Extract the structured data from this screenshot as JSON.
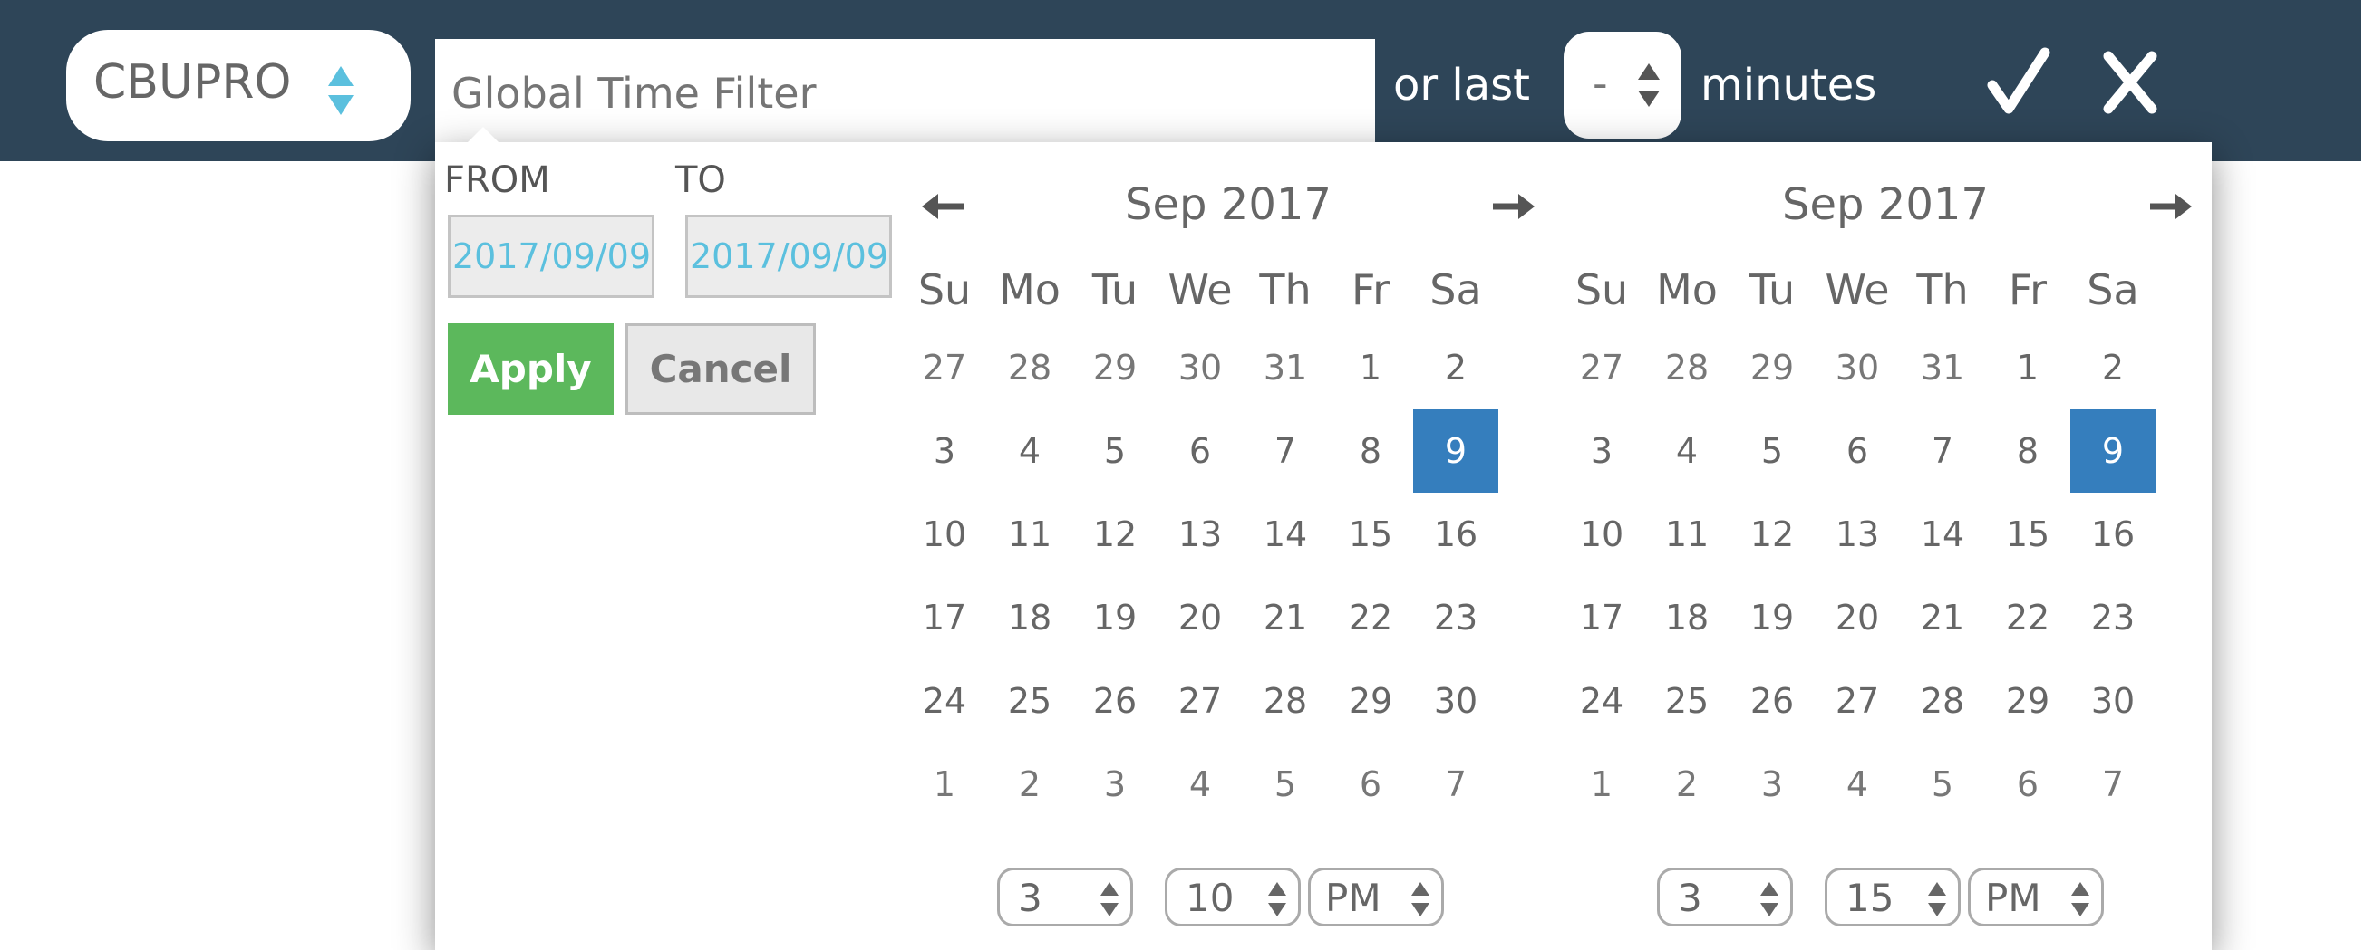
{
  "topbar": {
    "site_select": {
      "value": "CBUPRO"
    },
    "filter_input": {
      "placeholder": "Global Time Filter"
    },
    "or_last_label": "or last",
    "minutes_select": {
      "value": "-"
    },
    "minutes_label": "minutes",
    "confirm_icon": "checkmark-icon",
    "close_icon": "close-x-icon"
  },
  "range": {
    "from_label": "FROM",
    "to_label": "TO",
    "from_value": "2017/09/09",
    "to_value": "2017/09/09",
    "apply_label": "Apply",
    "cancel_label": "Cancel"
  },
  "colors": {
    "topbar_bg": "#2e4558",
    "apply_bg": "#5cb85c",
    "active_day_bg": "#357ebd",
    "date_text": "#5bc0de"
  },
  "calendars": [
    {
      "title": "Sep 2017",
      "weekdays": [
        "Su",
        "Mo",
        "Tu",
        "We",
        "Th",
        "Fr",
        "Sa"
      ],
      "weeks": [
        [
          "27",
          "28",
          "29",
          "30",
          "31",
          "1",
          "2"
        ],
        [
          "3",
          "4",
          "5",
          "6",
          "7",
          "8",
          "9"
        ],
        [
          "10",
          "11",
          "12",
          "13",
          "14",
          "15",
          "16"
        ],
        [
          "17",
          "18",
          "19",
          "20",
          "21",
          "22",
          "23"
        ],
        [
          "24",
          "25",
          "26",
          "27",
          "28",
          "29",
          "30"
        ],
        [
          "1",
          "2",
          "3",
          "4",
          "5",
          "6",
          "7"
        ]
      ],
      "selected_day": "9",
      "time": {
        "hour": "3",
        "minute": "10",
        "ampm": "PM"
      }
    },
    {
      "title": "Sep 2017",
      "weekdays": [
        "Su",
        "Mo",
        "Tu",
        "We",
        "Th",
        "Fr",
        "Sa"
      ],
      "weeks": [
        [
          "27",
          "28",
          "29",
          "30",
          "31",
          "1",
          "2"
        ],
        [
          "3",
          "4",
          "5",
          "6",
          "7",
          "8",
          "9"
        ],
        [
          "10",
          "11",
          "12",
          "13",
          "14",
          "15",
          "16"
        ],
        [
          "17",
          "18",
          "19",
          "20",
          "21",
          "22",
          "23"
        ],
        [
          "24",
          "25",
          "26",
          "27",
          "28",
          "29",
          "30"
        ],
        [
          "1",
          "2",
          "3",
          "4",
          "5",
          "6",
          "7"
        ]
      ],
      "selected_day": "9",
      "time": {
        "hour": "3",
        "minute": "15",
        "ampm": "PM"
      }
    }
  ]
}
